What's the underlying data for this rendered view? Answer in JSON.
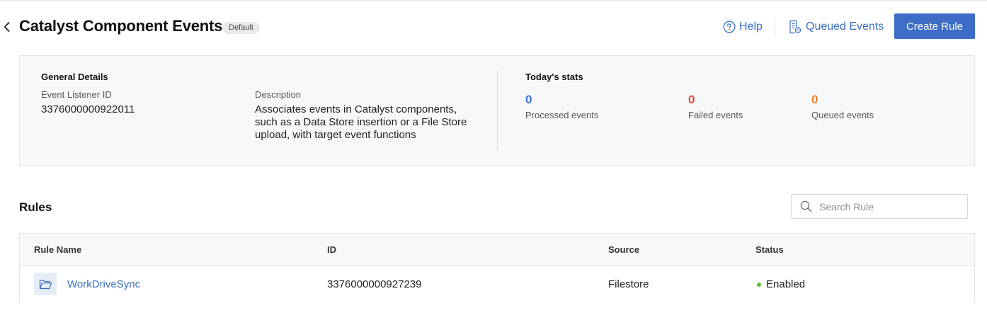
{
  "header": {
    "title": "Catalyst Component Events",
    "badge": "Default",
    "help_label": "Help",
    "queued_label": "Queued Events",
    "create_label": "Create Rule"
  },
  "general": {
    "section_title": "General Details",
    "listener_id_label": "Event Listener ID",
    "listener_id_value": "3376000000922011",
    "description_label": "Description",
    "description_lines": [
      "Associates events in Catalyst components,",
      "such as a Data Store insertion or a File Store",
      "upload, with target event functions"
    ]
  },
  "stats": {
    "section_title": "Today's stats",
    "processed": {
      "value": "0",
      "label": "Processed events",
      "color": "#3a72d8"
    },
    "failed": {
      "value": "0",
      "label": "Failed events",
      "color": "#e34b3a"
    },
    "queued": {
      "value": "0",
      "label": "Queued events",
      "color": "#ef7d2b"
    }
  },
  "rules": {
    "title": "Rules",
    "search_placeholder": "Search Rule",
    "columns": [
      "Rule Name",
      "ID",
      "Source",
      "Status"
    ],
    "rows": [
      {
        "name": "WorkDriveSync",
        "icon": "folder-icon",
        "id": "3376000000927239",
        "source": "Filestore",
        "status": "Enabled",
        "status_color": "#5bc236"
      }
    ]
  },
  "colors": {
    "accent": "#3d6dc6",
    "link": "#3a6fc4"
  }
}
